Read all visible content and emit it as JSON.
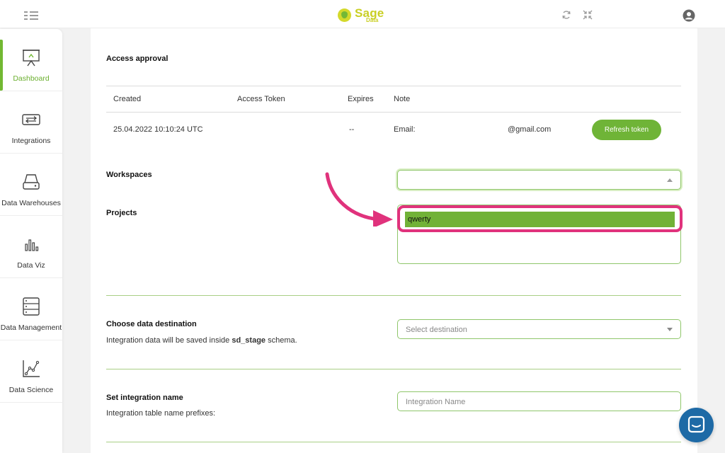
{
  "app": {
    "logo_name": "Sage",
    "logo_sub": "Data"
  },
  "topbar": {
    "icons": [
      "menu-toggle-icon",
      "refresh-icon",
      "collapse-icon",
      "user-avatar-icon"
    ]
  },
  "sidebar": {
    "items": [
      {
        "label": "Dashboard",
        "icon": "presentation-board-icon",
        "active": true
      },
      {
        "label": "Integrations",
        "icon": "arrows-swap-icon",
        "active": false
      },
      {
        "label": "Data Warehouses",
        "icon": "hard-drive-icon",
        "active": false
      },
      {
        "label": "Data Viz",
        "icon": "bar-chart-icon",
        "active": false
      },
      {
        "label": "Data Management",
        "icon": "server-rack-icon",
        "active": false
      },
      {
        "label": "Data Science",
        "icon": "line-graph-icon",
        "active": false
      }
    ]
  },
  "access": {
    "title": "Access approval",
    "columns": [
      "Created",
      "Access Token",
      "Expires",
      "Note"
    ],
    "row": {
      "created": "25.04.2022 10:10:24 UTC",
      "token": "",
      "expires": "--",
      "note_label": "Email:",
      "note_value": "@gmail.com"
    },
    "refresh_label": "Refresh token"
  },
  "workspaces": {
    "label": "Workspaces",
    "value": ""
  },
  "projects": {
    "label": "Projects",
    "options": [
      "qwerty"
    ]
  },
  "destination": {
    "title": "Choose data destination",
    "desc_prefix": "Integration data will be saved inside ",
    "desc_schema": "sd_stage",
    "desc_suffix": " schema.",
    "placeholder": "Select destination"
  },
  "integration_name": {
    "title": "Set integration name",
    "desc": "Integration table name prefixes:",
    "placeholder": "Integration Name"
  },
  "colors": {
    "accent": "#72b832",
    "highlight": "#e0327c",
    "chat": "#1e6aa6"
  }
}
